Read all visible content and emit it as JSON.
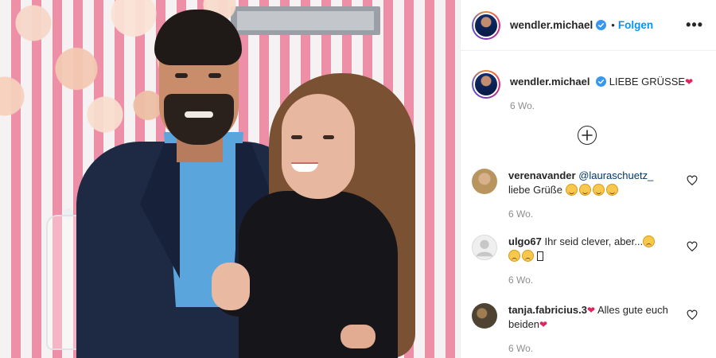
{
  "post": {
    "photo_alt": "",
    "author": {
      "username": "wendler.michael",
      "verified": true
    },
    "header": {
      "separator": "•",
      "follow_label": "Folgen",
      "more_label": "•••"
    },
    "caption": {
      "text": "LIEBE GRÜSSE",
      "heart": "❤",
      "time": "6 Wo."
    },
    "comments": [
      {
        "username": "verenavander",
        "mention": "@lauraschuetz_",
        "text": "liebe Grüße",
        "emoji_count": 4,
        "time": "6 Wo."
      },
      {
        "username": "ulgo67",
        "text": "Ihr seid clever, aber...",
        "time": "6 Wo."
      },
      {
        "username": "tanja.fabricius.3",
        "text": "Alles gute euch beiden",
        "heart": "❤",
        "time": "6 Wo."
      }
    ]
  },
  "colors": {
    "link_blue": "#0095f6",
    "mention_blue": "#00376b",
    "meta_gray": "#8e8e8e",
    "verified_blue": "#3897f0"
  }
}
